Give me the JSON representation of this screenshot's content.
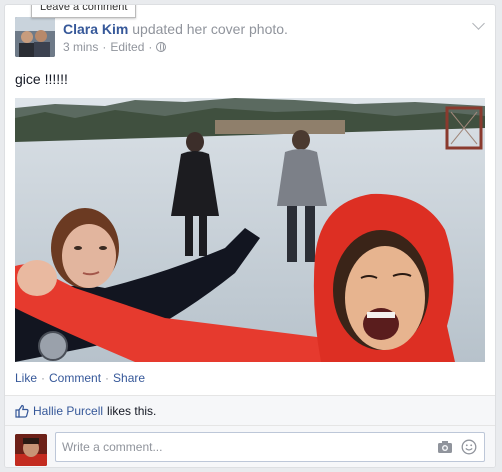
{
  "tooltip": "Leave a comment",
  "post": {
    "author": "Clara Kim",
    "action": "updated her cover photo.",
    "time": "3 mins",
    "edited": "Edited",
    "text": "gice !!!!!!"
  },
  "actions": {
    "like": "Like",
    "comment": "Comment",
    "share": "Share",
    "separator": "·"
  },
  "likes": {
    "name": "Hallie Purcell",
    "suffix": "likes this."
  },
  "comment_box": {
    "placeholder": "Write a comment..."
  },
  "colors": {
    "link": "#365899",
    "muted": "#90949c",
    "jacket_red": "#e63a2e"
  },
  "icons": [
    "chevron-down-icon",
    "globe-icon",
    "thumbs-up-icon",
    "camera-icon",
    "emoji-icon"
  ]
}
